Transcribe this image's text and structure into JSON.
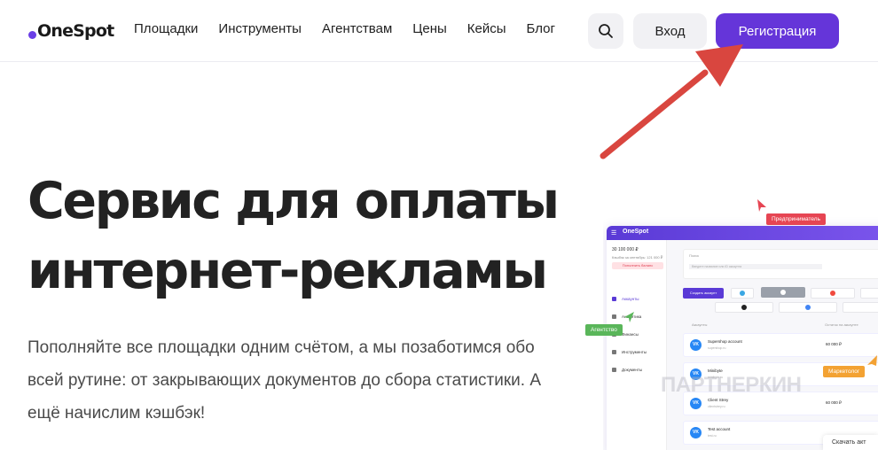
{
  "header": {
    "logo_text": "OneSpot",
    "nav": [
      "Площадки",
      "Инструменты",
      "Агентствам",
      "Цены",
      "Кейсы",
      "Блог"
    ],
    "search_icon": "search-icon",
    "login_label": "Вход",
    "register_label": "Регистрация"
  },
  "hero": {
    "title_line1": "Сервис для оплаты",
    "title_line2": "интернет-рекламы",
    "subtitle": "Пополняйте все площадки одним счётом, а мы позаботимся обо всей рутине: от закрывающих документов до сбора статистики. А ещё начислим кэшбэк!"
  },
  "mockup": {
    "brand": "OneSpot",
    "balance": "30 100 000 ₽",
    "balance_note": "Кэшбэк за сентябрь: 121 000 ₽",
    "topup": "Пополнить баланс",
    "menu": [
      "Аккаунты",
      "Аналитика",
      "Финансы",
      "Инструменты",
      "Документы"
    ],
    "search_label": "Поиск",
    "search_placeholder": "Введите название или ID аккаунта",
    "create_label": "Создать аккаунт",
    "col_accounts": "Аккаунты",
    "col_balance": "Остаток на аккаунте",
    "accounts": [
      {
        "name": "Supershop account",
        "sub": "supershop.ru",
        "balance": "60 000 ₽"
      },
      {
        "name": "Minibyte",
        "sub": "minibyte.ru",
        "balance": "60 000 ₽"
      },
      {
        "name": "Client Strey",
        "sub": "clientstrey.ru",
        "balance": "60 000 ₽"
      },
      {
        "name": "Test account",
        "sub": "test.ru",
        "balance": ""
      }
    ]
  },
  "tags": {
    "entrepreneur": "Предприниматель",
    "agency": "Агентство",
    "marketer": "Маркетолог"
  },
  "watermark": "ПАРТНЕРКИН",
  "chat_label": "Скачать акт",
  "colors": {
    "brand": "#6535d9",
    "arrow": "#d9463f"
  }
}
